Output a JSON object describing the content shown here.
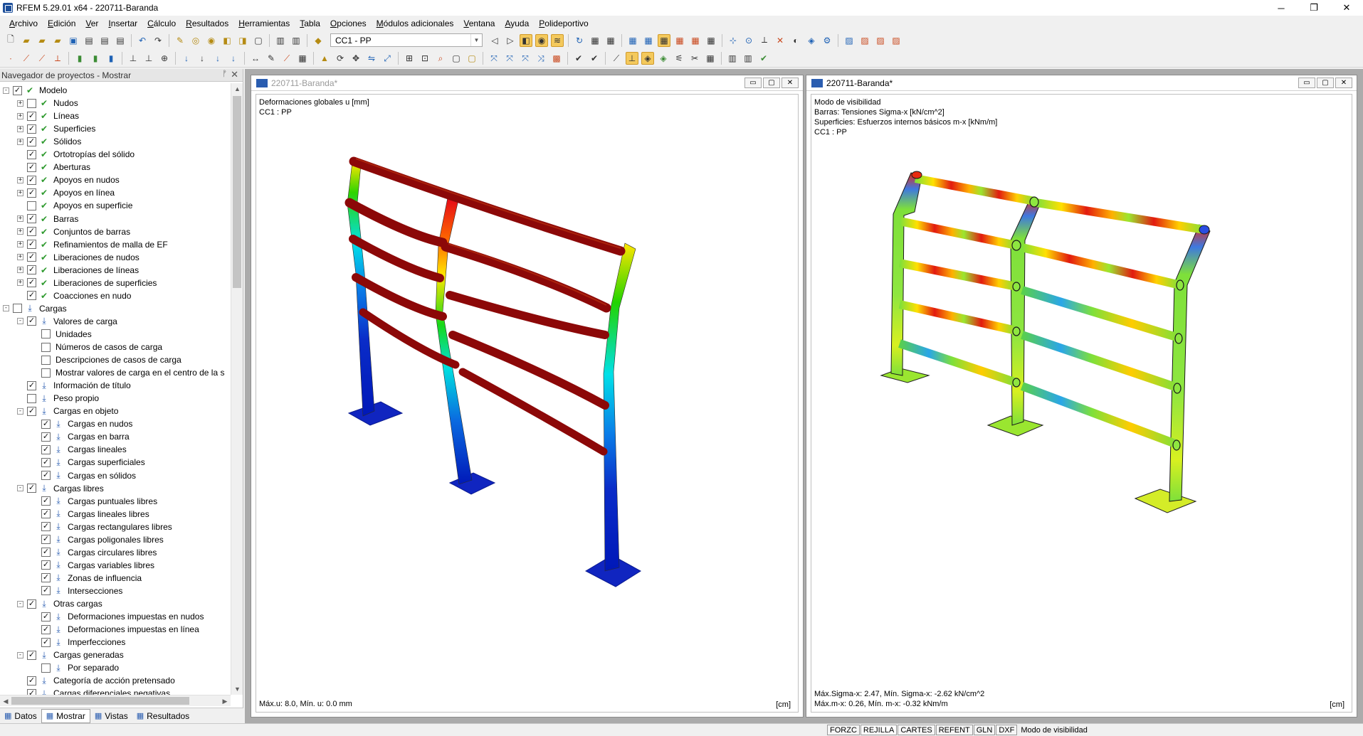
{
  "window": {
    "title": "RFEM 5.29.01 x64 - 220711-Baranda",
    "minimize": "─",
    "restore": "❐",
    "close": "✕"
  },
  "menu": [
    "Archivo",
    "Edición",
    "Ver",
    "Insertar",
    "Cálculo",
    "Resultados",
    "Herramientas",
    "Tabla",
    "Opciones",
    "Módulos adicionales",
    "Ventana",
    "Ayuda",
    "Polideportivo"
  ],
  "toolbar": {
    "load_case": "CC1 - PP"
  },
  "navigator": {
    "title": "Navegador de proyectos - Mostrar",
    "pin": "ᚡ",
    "close": "✕",
    "items": [
      {
        "label": "Modelo",
        "level": 0,
        "expander": "-",
        "check": "✓",
        "icon": "green"
      },
      {
        "label": "Nudos",
        "level": 1,
        "expander": "+",
        "check": "",
        "icon": "green"
      },
      {
        "label": "Líneas",
        "level": 1,
        "expander": "+",
        "check": "✓",
        "icon": "green"
      },
      {
        "label": "Superficies",
        "level": 1,
        "expander": "+",
        "check": "✓",
        "icon": "green"
      },
      {
        "label": "Sólidos",
        "level": 1,
        "expander": "+",
        "check": "✓",
        "icon": "green"
      },
      {
        "label": "Ortotropías del sólido",
        "level": 1,
        "expander": "",
        "check": "✓",
        "icon": "green"
      },
      {
        "label": "Aberturas",
        "level": 1,
        "expander": "",
        "check": "✓",
        "icon": "green"
      },
      {
        "label": "Apoyos en nudos",
        "level": 1,
        "expander": "+",
        "check": "✓",
        "icon": "green"
      },
      {
        "label": "Apoyos en línea",
        "level": 1,
        "expander": "+",
        "check": "✓",
        "icon": "green"
      },
      {
        "label": "Apoyos en superficie",
        "level": 1,
        "expander": "",
        "check": "",
        "icon": "green"
      },
      {
        "label": "Barras",
        "level": 1,
        "expander": "+",
        "check": "✓",
        "icon": "green"
      },
      {
        "label": "Conjuntos de barras",
        "level": 1,
        "expander": "+",
        "check": "✓",
        "icon": "green"
      },
      {
        "label": "Refinamientos de malla de EF",
        "level": 1,
        "expander": "+",
        "check": "✓",
        "icon": "green"
      },
      {
        "label": "Liberaciones de nudos",
        "level": 1,
        "expander": "+",
        "check": "✓",
        "icon": "green"
      },
      {
        "label": "Liberaciones de líneas",
        "level": 1,
        "expander": "+",
        "check": "✓",
        "icon": "green"
      },
      {
        "label": "Liberaciones de superficies",
        "level": 1,
        "expander": "+",
        "check": "✓",
        "icon": "green"
      },
      {
        "label": "Coacciones en nudo",
        "level": 1,
        "expander": "",
        "check": "✓",
        "icon": "green"
      },
      {
        "label": "Cargas",
        "level": 0,
        "expander": "-",
        "check": "",
        "icon": "blue"
      },
      {
        "label": "Valores de carga",
        "level": 1,
        "expander": "-",
        "check": "✓",
        "icon": "blue"
      },
      {
        "label": "Unidades",
        "level": 2,
        "expander": "",
        "check": "",
        "icon": "none"
      },
      {
        "label": "Números de casos de carga",
        "level": 2,
        "expander": "",
        "check": "",
        "icon": "none"
      },
      {
        "label": "Descripciones de casos de carga",
        "level": 2,
        "expander": "",
        "check": "",
        "icon": "none"
      },
      {
        "label": "Mostrar valores de carga en el centro de la s",
        "level": 2,
        "expander": "",
        "check": "",
        "icon": "none"
      },
      {
        "label": "Información de título",
        "level": 1,
        "expander": "",
        "check": "✓",
        "icon": "blue"
      },
      {
        "label": "Peso propio",
        "level": 1,
        "expander": "",
        "check": "",
        "icon": "blue"
      },
      {
        "label": "Cargas en objeto",
        "level": 1,
        "expander": "-",
        "check": "✓",
        "icon": "blue"
      },
      {
        "label": "Cargas en nudos",
        "level": 2,
        "expander": "",
        "check": "✓",
        "icon": "blue"
      },
      {
        "label": "Cargas en barra",
        "level": 2,
        "expander": "",
        "check": "✓",
        "icon": "blue"
      },
      {
        "label": "Cargas lineales",
        "level": 2,
        "expander": "",
        "check": "✓",
        "icon": "blue"
      },
      {
        "label": "Cargas superficiales",
        "level": 2,
        "expander": "",
        "check": "✓",
        "icon": "blue"
      },
      {
        "label": "Cargas en sólidos",
        "level": 2,
        "expander": "",
        "check": "✓",
        "icon": "blue"
      },
      {
        "label": "Cargas libres",
        "level": 1,
        "expander": "-",
        "check": "✓",
        "icon": "blue"
      },
      {
        "label": "Cargas puntuales libres",
        "level": 2,
        "expander": "",
        "check": "✓",
        "icon": "blue"
      },
      {
        "label": "Cargas lineales libres",
        "level": 2,
        "expander": "",
        "check": "✓",
        "icon": "blue"
      },
      {
        "label": "Cargas rectangulares libres",
        "level": 2,
        "expander": "",
        "check": "✓",
        "icon": "blue"
      },
      {
        "label": "Cargas poligonales libres",
        "level": 2,
        "expander": "",
        "check": "✓",
        "icon": "blue"
      },
      {
        "label": "Cargas circulares libres",
        "level": 2,
        "expander": "",
        "check": "✓",
        "icon": "blue"
      },
      {
        "label": "Cargas variables libres",
        "level": 2,
        "expander": "",
        "check": "✓",
        "icon": "blue"
      },
      {
        "label": "Zonas de influencia",
        "level": 2,
        "expander": "",
        "check": "✓",
        "icon": "blue"
      },
      {
        "label": "Intersecciones",
        "level": 2,
        "expander": "",
        "check": "✓",
        "icon": "blue"
      },
      {
        "label": "Otras cargas",
        "level": 1,
        "expander": "-",
        "check": "✓",
        "icon": "blue"
      },
      {
        "label": "Deformaciones impuestas en nudos",
        "level": 2,
        "expander": "",
        "check": "✓",
        "icon": "blue"
      },
      {
        "label": "Deformaciones impuestas en línea",
        "level": 2,
        "expander": "",
        "check": "✓",
        "icon": "blue"
      },
      {
        "label": "Imperfecciones",
        "level": 2,
        "expander": "",
        "check": "✓",
        "icon": "blue"
      },
      {
        "label": "Cargas generadas",
        "level": 1,
        "expander": "-",
        "check": "✓",
        "icon": "blue"
      },
      {
        "label": "Por separado",
        "level": 2,
        "expander": "",
        "check": "",
        "icon": "blue"
      },
      {
        "label": "Categoría de acción pretensado",
        "level": 1,
        "expander": "",
        "check": "✓",
        "icon": "blue"
      },
      {
        "label": "Cargas diferenciales negativas",
        "level": 1,
        "expander": "",
        "check": "✓",
        "icon": "blue"
      }
    ],
    "tabs": [
      {
        "label": "Datos",
        "icon": "▦"
      },
      {
        "label": "Mostrar",
        "icon": "▦"
      },
      {
        "label": "Vistas",
        "icon": "▦"
      },
      {
        "label": "Resultados",
        "icon": "▦"
      }
    ]
  },
  "view_left": {
    "title": "220711-Baranda*",
    "info": [
      "Deformaciones globales u [mm]",
      "CC1 : PP"
    ],
    "footer": "Máx.u: 8.0, Mín. u: 0.0 mm",
    "unit": "[cm]"
  },
  "view_right": {
    "title": "220711-Baranda*",
    "info": [
      "Modo de visibilidad",
      "Barras: Tensiones Sigma-x [kN/cm^2]",
      "Superficies: Esfuerzos internos básicos m-x [kNm/m]",
      "CC1 : PP"
    ],
    "footer": [
      "Máx.Sigma-x: 2.47, Mín. Sigma-x: -2.62 kN/cm^2",
      "Máx.m-x: 0.26, Mín. m-x: -0.32 kNm/m"
    ],
    "unit": "[cm]"
  },
  "statusbar": {
    "buttons": [
      "FORZC",
      "REJILLA",
      "CARTES",
      "REFENT",
      "GLN",
      "DXF"
    ],
    "text": "Modo de visibilidad"
  }
}
